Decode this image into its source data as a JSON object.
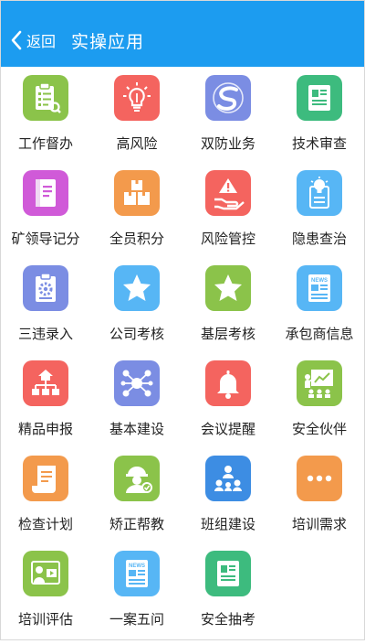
{
  "header": {
    "back_label": "返回",
    "title": "实操应用",
    "back_icon": "chevron-left-icon",
    "color": "#1c9cf0"
  },
  "apps": [
    {
      "id": "gzdb",
      "label": "工作督办",
      "icon": "checklist-icon",
      "color": "#8bc34a"
    },
    {
      "id": "gfx",
      "label": "高风险",
      "icon": "lightbulb-icon",
      "color": "#f4645f"
    },
    {
      "id": "sfyw",
      "label": "双防业务",
      "icon": "swirl-logo-icon",
      "color": "#7b8de3"
    },
    {
      "id": "jssc",
      "label": "技术审查",
      "icon": "document-icon",
      "color": "#3dbb7e"
    },
    {
      "id": "kldjf",
      "label": "矿领导记分",
      "icon": "notebook-icon",
      "color": "#d05ad8"
    },
    {
      "id": "qyjf",
      "label": "全员积分",
      "icon": "boxes-icon",
      "color": "#f39a4c"
    },
    {
      "id": "fxgk",
      "label": "风险管控",
      "icon": "hand-alert-icon",
      "color": "#f4645f"
    },
    {
      "id": "yhcz",
      "label": "隐患查治",
      "icon": "lightbulb-doc-icon",
      "color": "#57b6f5"
    },
    {
      "id": "swlr",
      "label": "三违录入",
      "icon": "clipboard-gear-icon",
      "color": "#7b8de3"
    },
    {
      "id": "gskh",
      "label": "公司考核",
      "icon": "star-icon",
      "color": "#57b6f5"
    },
    {
      "id": "jckh",
      "label": "基层考核",
      "icon": "star-icon",
      "color": "#8bc34a"
    },
    {
      "id": "cbsxx",
      "label": "承包商信息",
      "icon": "news-icon",
      "color": "#57b6f5"
    },
    {
      "id": "jpsb",
      "label": "精品申报",
      "icon": "hierarchy-icon",
      "color": "#f4645f"
    },
    {
      "id": "jbjs",
      "label": "基本建设",
      "icon": "network-icon",
      "color": "#7b8de3"
    },
    {
      "id": "hytx",
      "label": "会议提醒",
      "icon": "bell-icon",
      "color": "#f4645f"
    },
    {
      "id": "aqhb",
      "label": "安全伙伴",
      "icon": "presentation-icon",
      "color": "#8bc34a"
    },
    {
      "id": "jcjh",
      "label": "检查计划",
      "icon": "scroll-icon",
      "color": "#f39a4c"
    },
    {
      "id": "jzbj",
      "label": "矫正帮教",
      "icon": "worker-icon",
      "color": "#8bc34a"
    },
    {
      "id": "bzjs",
      "label": "班组建设",
      "icon": "team-icon",
      "color": "#3d8de3"
    },
    {
      "id": "pxxq",
      "label": "培训需求",
      "icon": "more-dots-icon",
      "color": "#f39a4c"
    },
    {
      "id": "pxpg",
      "label": "培训评估",
      "icon": "video-lesson-icon",
      "color": "#8bc34a"
    },
    {
      "id": "yawi",
      "label": "一案五问",
      "icon": "news-icon",
      "color": "#57b6f5"
    },
    {
      "id": "aqck",
      "label": "安全抽考",
      "icon": "document-icon",
      "color": "#3dbb7e"
    }
  ]
}
